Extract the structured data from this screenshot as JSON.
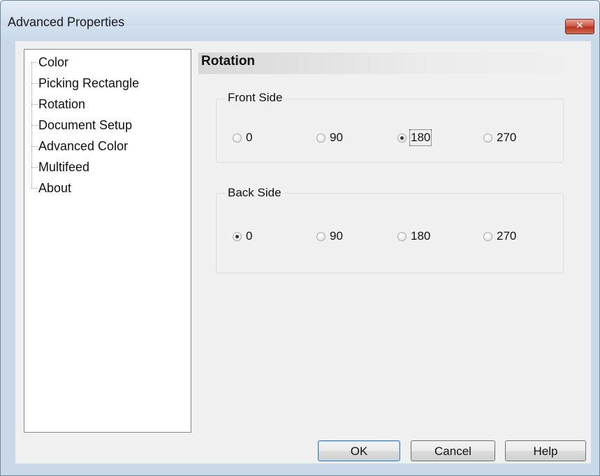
{
  "window": {
    "title": "Advanced Properties",
    "close_glyph": "✕"
  },
  "tree": {
    "items": [
      {
        "label": "Color"
      },
      {
        "label": "Picking Rectangle"
      },
      {
        "label": "Rotation"
      },
      {
        "label": "Document Setup"
      },
      {
        "label": "Advanced Color"
      },
      {
        "label": "Multifeed"
      },
      {
        "label": "About"
      }
    ]
  },
  "section": {
    "title": "Rotation"
  },
  "front_side": {
    "label": "Front Side",
    "options": [
      "0",
      "90",
      "180",
      "270"
    ],
    "selected": "180"
  },
  "back_side": {
    "label": "Back Side",
    "options": [
      "0",
      "90",
      "180",
      "270"
    ],
    "selected": "0"
  },
  "buttons": {
    "ok": "OK",
    "cancel": "Cancel",
    "help": "Help"
  }
}
